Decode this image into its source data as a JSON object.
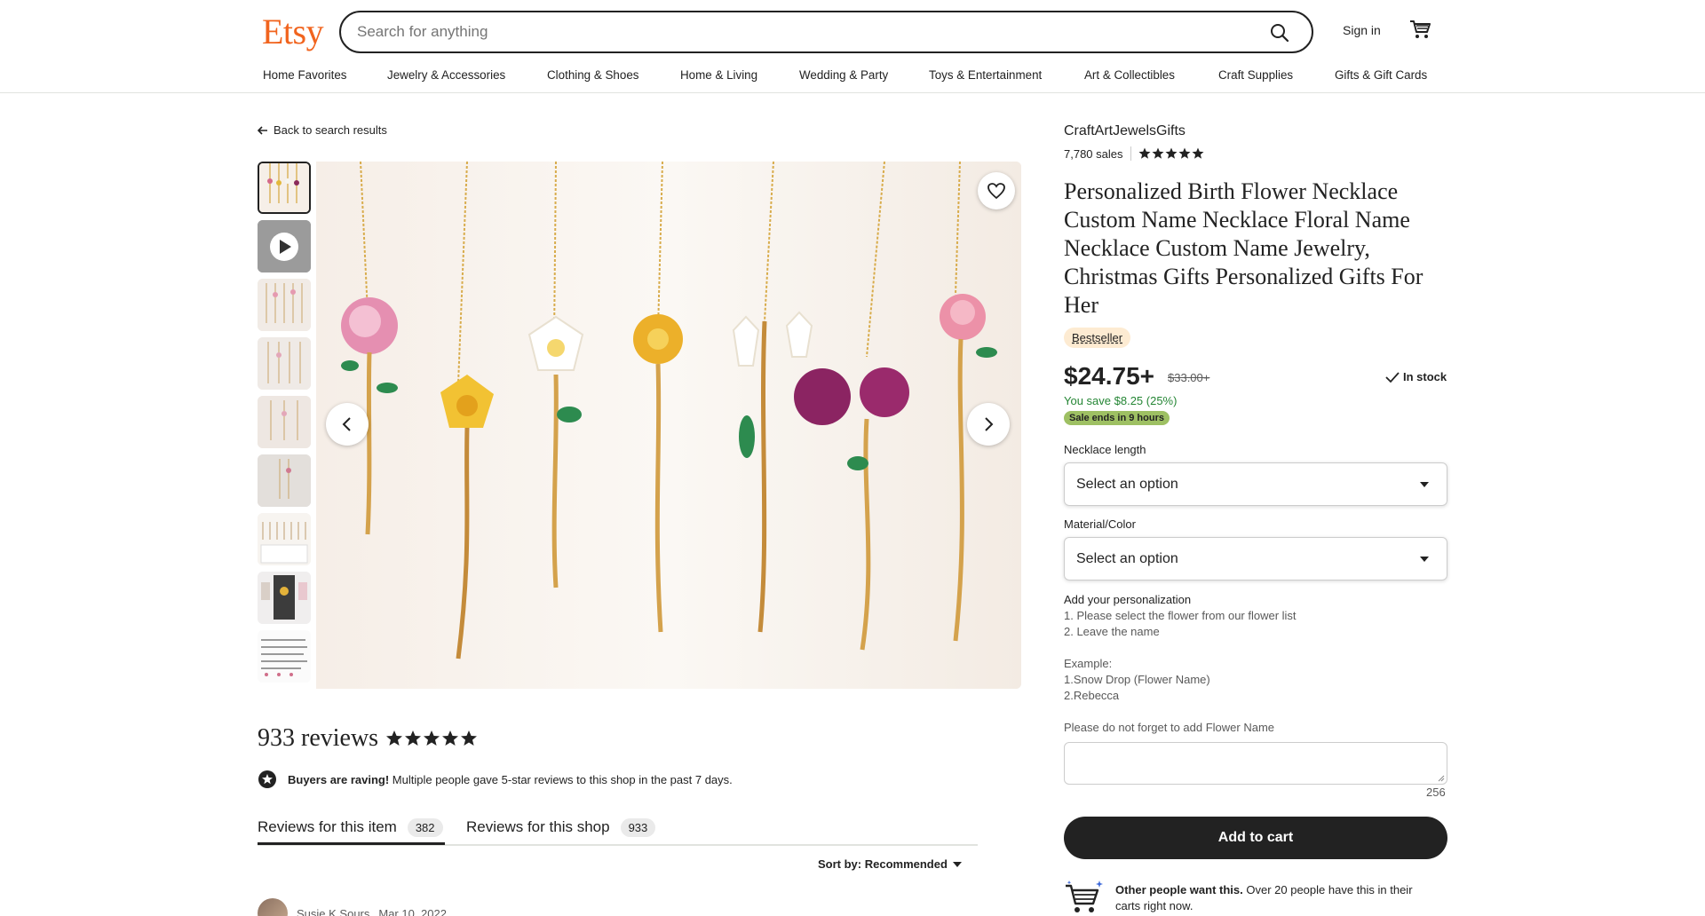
{
  "header": {
    "logo": "Etsy",
    "search_placeholder": "Search for anything",
    "sign_in": "Sign in",
    "icons": [
      "search-icon",
      "cart-icon"
    ]
  },
  "nav": [
    "Home Favorites",
    "Jewelry & Accessories",
    "Clothing & Shoes",
    "Home & Living",
    "Wedding & Party",
    "Toys & Entertainment",
    "Art & Collectibles",
    "Craft Supplies",
    "Gifts & Gift Cards"
  ],
  "back_link": "Back to search results",
  "gallery": {
    "thumbnail_count": 9,
    "selected_index": 0,
    "icons": [
      "heart-icon",
      "chevron-left-icon",
      "chevron-right-icon",
      "play-icon"
    ]
  },
  "reviews": {
    "title": "933 reviews",
    "rating_stars": 5,
    "raving_bold": "Buyers are raving!",
    "raving_text": " Multiple people gave 5-star reviews to this shop in the past 7 days.",
    "tabs": [
      {
        "label": "Reviews for this item",
        "count": "382"
      },
      {
        "label": "Reviews for this shop",
        "count": "933"
      }
    ],
    "sort_label": "Sort by: Recommended",
    "first_reviewer": "Susie K Sours",
    "first_date": "Mar 10, 2022"
  },
  "product": {
    "shop_name": "CraftArtJewelsGifts",
    "sales": "7,780 sales",
    "shop_rating_stars": 5,
    "title": "Personalized Birth Flower Necklace Custom Name Necklace Floral Name Necklace Custom Name Jewelry, Christmas Gifts Personalized Gifts For Her",
    "badge": "Bestseller",
    "price": "$24.75+",
    "original_price": "$33.00+",
    "stock": "In stock",
    "savings": "You save $8.25 (25%)",
    "sale_ends": "Sale ends in 9 hours",
    "option1_label": "Necklace length",
    "option1_value": "Select an option",
    "option2_label": "Material/Color",
    "option2_value": "Select an option",
    "personalization_label": "Add your personalization",
    "personalization_lines": [
      "1. Please select the flower from our flower list",
      "2. Leave the name",
      "Example:",
      "1.Snow Drop (Flower Name)",
      "2.Rebecca",
      "Please do not forget to add Flower Name"
    ],
    "char_remaining": "256",
    "add_to_cart": "Add to cart",
    "other_people_bold": "Other people want this.",
    "other_people_text": " Over 20 people have this in their carts right now."
  },
  "colors": {
    "brand": "#f1641e",
    "sale_green": "#258635",
    "sale_badge": "#9ec063",
    "bestseller_bg": "#fdebd2"
  }
}
